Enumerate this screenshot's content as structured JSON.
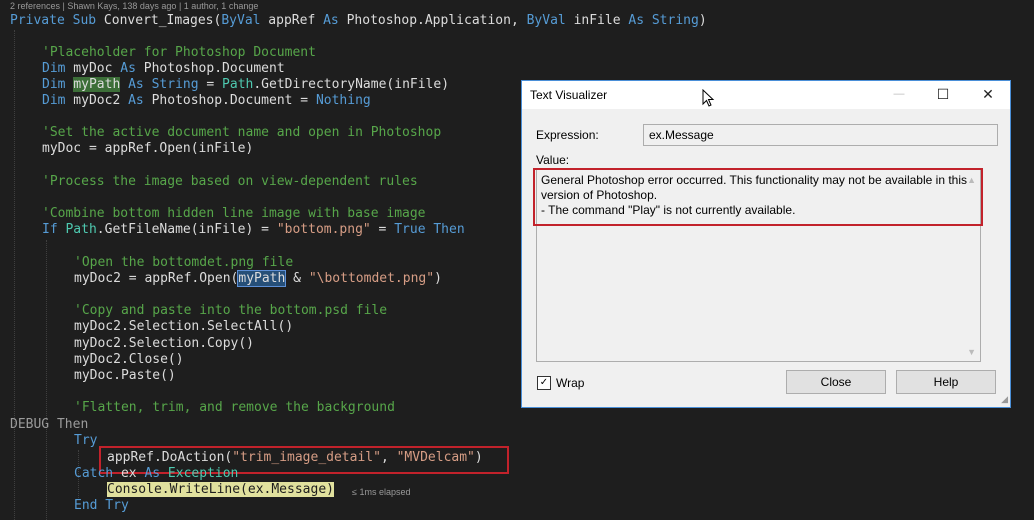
{
  "editor": {
    "codelens": "2 references | Shawn Kays, 138 days ago | 1 author, 1 change",
    "sub_kw1": "Private",
    "sub_kw2": "Sub",
    "sub_name": " Convert_Images(",
    "byval1": "ByVal",
    "param1": " appRef ",
    "as1": "As",
    "param1_type": " Photoshop.Application, ",
    "byval2": "ByVal",
    "param2": " inFile ",
    "as2": "As",
    "param2_type": " String",
    "close_paren": ")",
    "c_placeholder": "'Placeholder for Photoshop Document",
    "dim1": "Dim",
    "dim1_var": " myDoc ",
    "dim1_as": "As",
    "dim1_type": " Photoshop.Document",
    "dim2": "Dim",
    "dim2_var": "myPath",
    "dim2_as": "As",
    "dim2_type": "String",
    "dim2_eq": " = ",
    "dim2_path": "Path",
    "dim2_call": ".GetDirectoryName(inFile)",
    "dim3": "Dim",
    "dim3_var": " myDoc2 ",
    "dim3_as": "As",
    "dim3_type": " Photoshop.Document = ",
    "dim3_nothing": "Nothing",
    "c_setactive": "'Set the active document name and open in Photoshop",
    "open_line": "myDoc = appRef.Open(inFile)",
    "c_process": "'Process the image based on view-dependent rules",
    "c_combine": "'Combine bottom hidden line image with base image",
    "if_kw": "If",
    "if_path": "Path",
    "if_mid": ".GetFileName(inFile) = ",
    "if_str": "\"bottom.png\"",
    "if_eq": " = ",
    "if_true": "True",
    "if_then": "Then",
    "c_open": "'Open the bottomdet.png file",
    "open2_a": "myDoc2 = appRef.Open(",
    "open2_var": "myPath",
    "open2_amp": " & ",
    "open2_str": "\"\\bottomdet.png\"",
    "open2_close": ")",
    "c_copy": "'Copy and paste into the bottom.psd file",
    "sel_all": "myDoc2.Selection.SelectAll()",
    "sel_copy": "myDoc2.Selection.Copy()",
    "close_line": "myDoc2.Close()",
    "paste_line": "myDoc.Paste()",
    "c_flatten": "'Flatten, trim, and remove the background",
    "debug_a": "DEBUG",
    "debug_then": "Then",
    "try_kw": "Try",
    "doaction_a": "appRef.DoAction(",
    "doaction_s1": "\"trim_image_detail\"",
    "doaction_comma": ", ",
    "doaction_s2": "\"MVDelcam\"",
    "doaction_close": ")",
    "catch_kw": "Catch",
    "catch_var": " ex ",
    "catch_as": "As",
    "catch_type": " Exception",
    "console_line": "Console.WriteLine(ex.Message)",
    "elapsed": "≤ 1ms elapsed",
    "end_try": "End Try"
  },
  "dialog": {
    "title": "Text Visualizer",
    "minimize_glyph": "—",
    "maximize_glyph": "☐",
    "close_glyph": "✕",
    "expression_label": "Expression:",
    "expression_value": "ex.Message",
    "value_label": "Value:",
    "value_line1": "General Photoshop error occurred. This functionality may not be available in this",
    "value_line2": "version of Photoshop.",
    "value_line3": "- The command \"Play\" is not currently available.",
    "wrap_label": "Wrap",
    "wrap_checked": true,
    "wrap_glyph": "✓",
    "close_button": "Close",
    "help_button": "Help",
    "scroll_up_glyph": "▲",
    "scroll_down_glyph": "▼",
    "grip_glyph": "◢"
  },
  "colors": {
    "editor_bg": "#1e1e1e",
    "keyword": "#569cd6",
    "comment": "#57a64a",
    "string": "#d69d85",
    "type": "#4ec9b0",
    "highlight_box": "#c2222b"
  }
}
